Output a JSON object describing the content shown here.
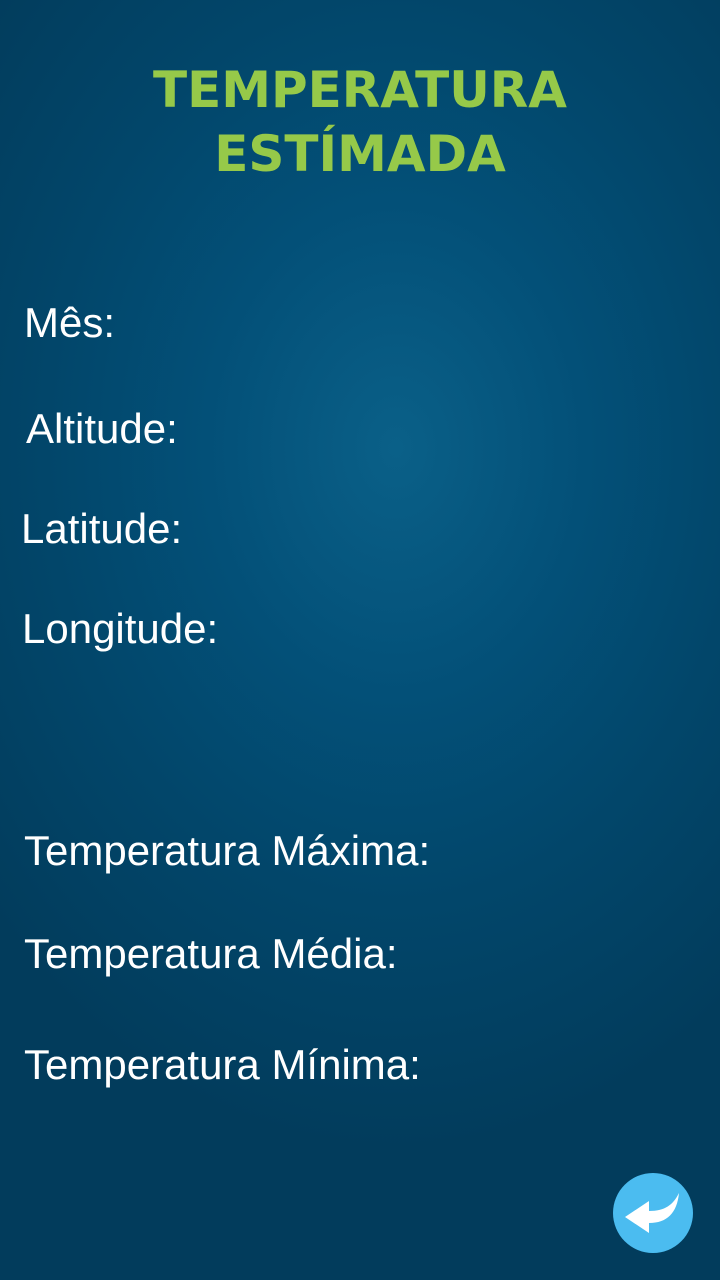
{
  "header": {
    "title_line1": "TEMPERATURA",
    "title_line2": "ESTÍMADA"
  },
  "fields": {
    "month_label": "Mês:",
    "altitude_label": "Altitude:",
    "latitude_label": "Latitude:",
    "longitude_label": "Longitude:"
  },
  "results": {
    "max_label": "Temperatura Máxima:",
    "avg_label": "Temperatura Média:",
    "min_label": "Temperatura Mínima:"
  },
  "footer": {
    "back_icon": "back-arrow-icon"
  },
  "colors": {
    "title": "#96c949",
    "background": "#035078",
    "button": "#4bbcf0",
    "text": "#ffffff"
  }
}
